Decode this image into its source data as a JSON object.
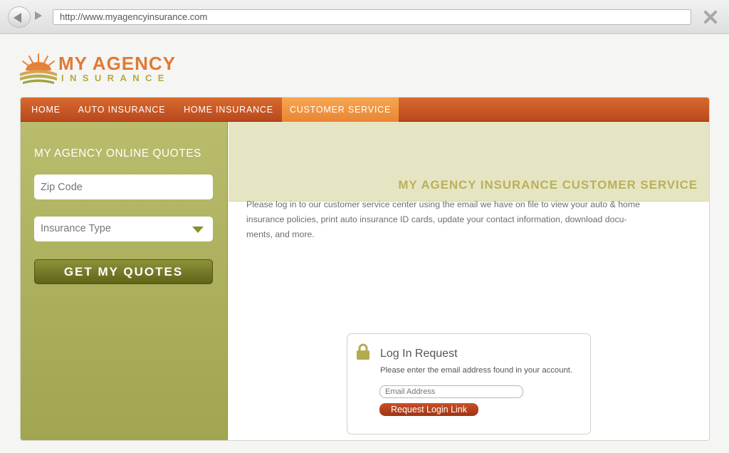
{
  "browser": {
    "url": "http://www.myagencyinsurance.com"
  },
  "logo": {
    "line1": "MY AGENCY",
    "line2": "INSURANCE"
  },
  "nav": {
    "items": [
      {
        "label": "HOME"
      },
      {
        "label": "AUTO INSURANCE"
      },
      {
        "label": "HOME INSURANCE"
      },
      {
        "label": "CUSTOMER SERVICE",
        "active": true
      }
    ]
  },
  "sidebar": {
    "title": "MY AGENCY ONLINE QUOTES",
    "zip_placeholder": "Zip Code",
    "insurance_type": "Insurance Type",
    "quote_button": "GET MY QUOTES"
  },
  "main": {
    "banner_title": "MY AGENCY INSURANCE CUSTOMER SERVICE",
    "intro_lines": [
      "Please log in to our customer service center using the email we have on file to view your auto & home",
      "insurance policies, print auto insurance ID cards, update your contact information, download docu-",
      "ments, and more."
    ]
  },
  "login": {
    "title": "Log In Request",
    "description": "Please enter the email address found in your account.",
    "email_placeholder": "Email Address",
    "button": "Request Login Link"
  },
  "colors": {
    "nav_orange": "#c9582a",
    "nav_active": "#f09a47",
    "sidebar_olive": "#abaf5d",
    "banner_cream": "#e6e5c3",
    "heading_olive": "#b9b158",
    "login_button": "#b5401b"
  }
}
